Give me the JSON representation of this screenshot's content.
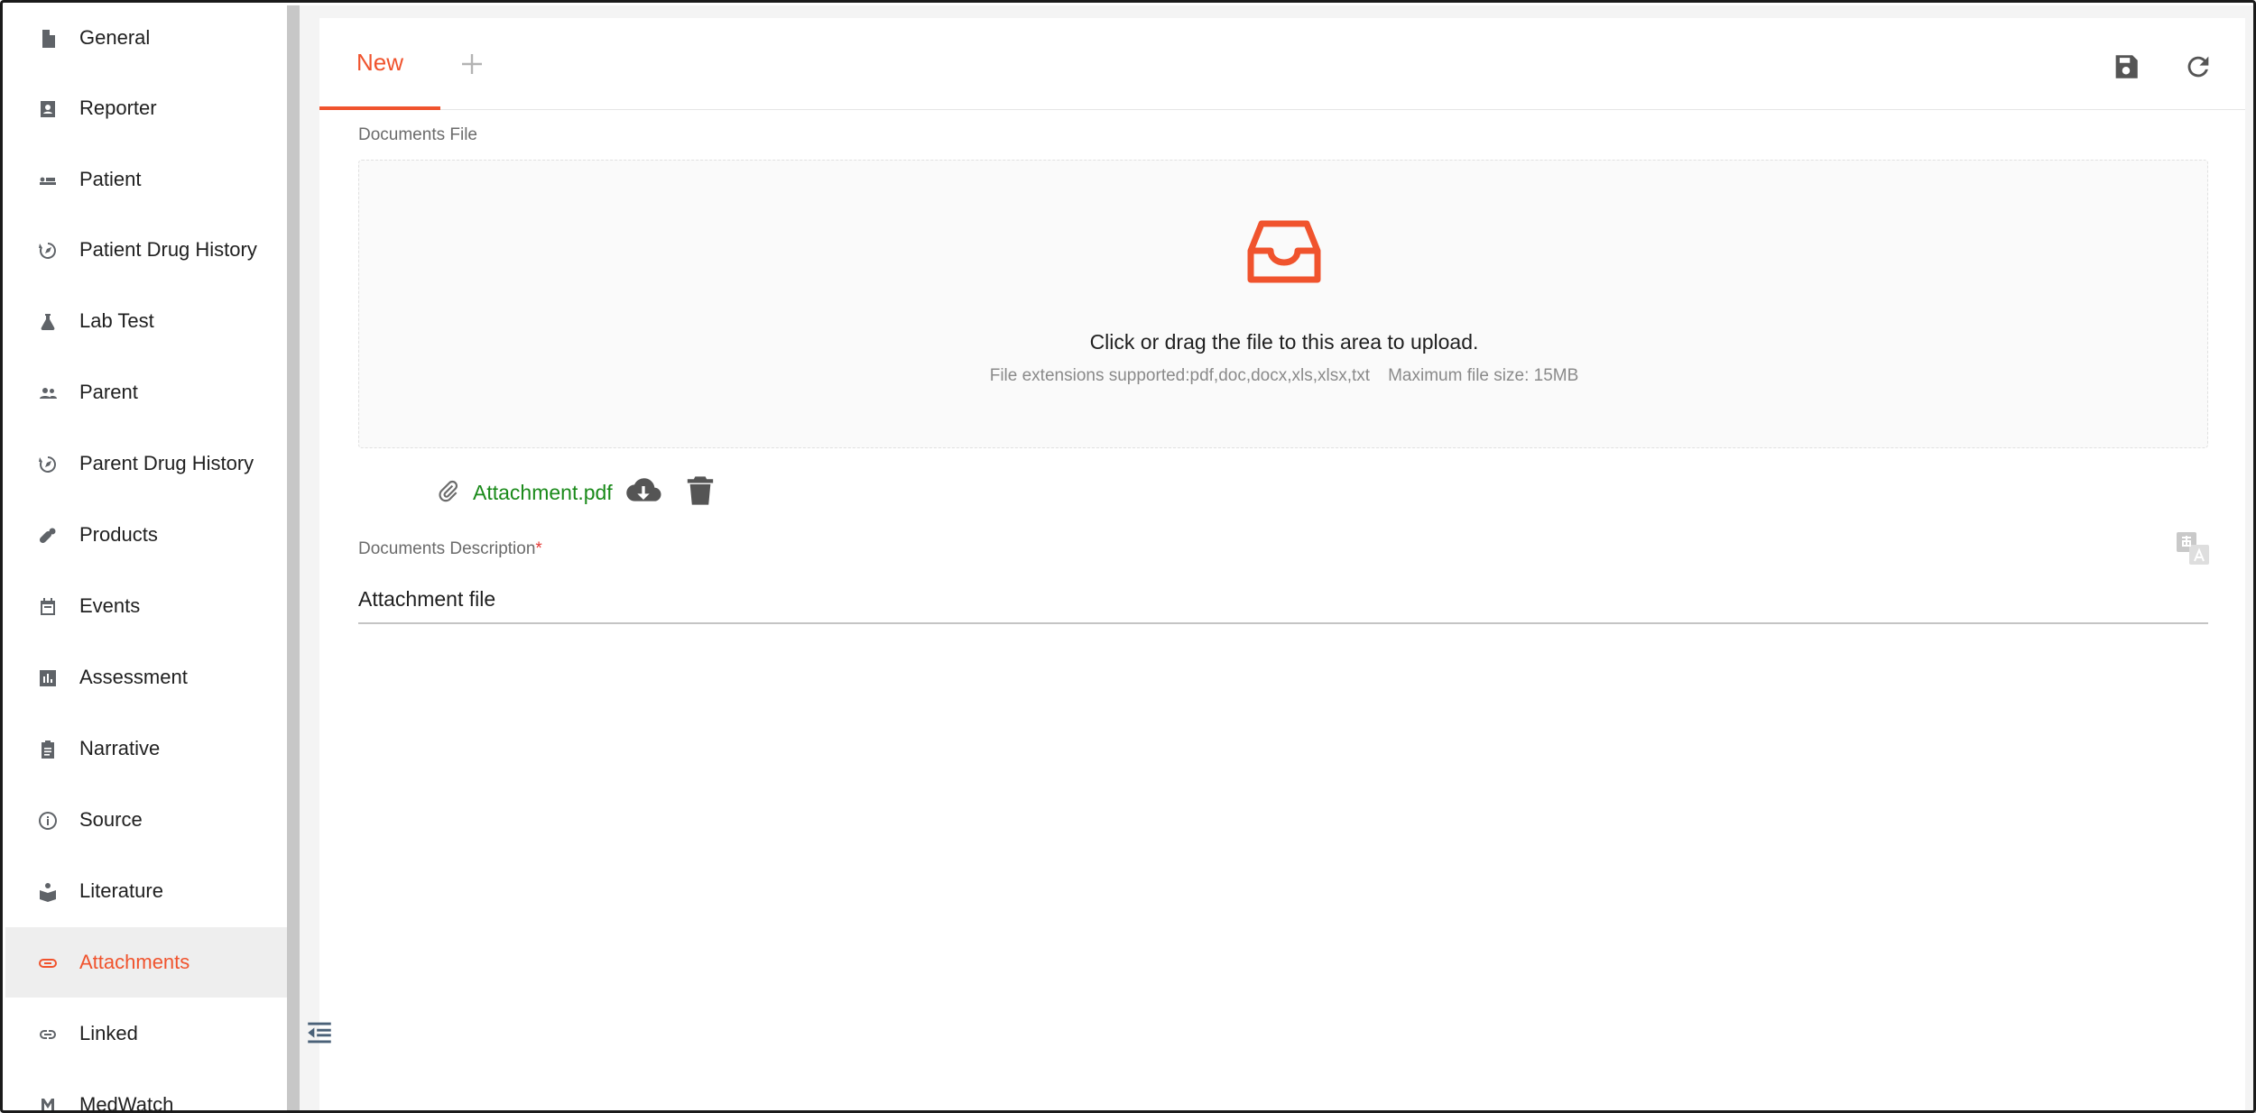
{
  "sidebar": {
    "items": [
      {
        "label": "General",
        "icon": "document-icon"
      },
      {
        "label": "Reporter",
        "icon": "contact-card-icon"
      },
      {
        "label": "Patient",
        "icon": "patient-bed-icon"
      },
      {
        "label": "Patient Drug History",
        "icon": "history-compass-icon"
      },
      {
        "label": "Lab Test",
        "icon": "lab-flask-icon"
      },
      {
        "label": "Parent",
        "icon": "people-icon"
      },
      {
        "label": "Parent Drug History",
        "icon": "history-compass-icon"
      },
      {
        "label": "Products",
        "icon": "pills-icon"
      },
      {
        "label": "Events",
        "icon": "calendar-icon"
      },
      {
        "label": "Assessment",
        "icon": "bar-chart-icon"
      },
      {
        "label": "Narrative",
        "icon": "clipboard-icon"
      },
      {
        "label": "Source",
        "icon": "info-icon"
      },
      {
        "label": "Literature",
        "icon": "reading-icon"
      },
      {
        "label": "Attachments",
        "icon": "paperclip-icon",
        "active": true
      },
      {
        "label": "Linked",
        "icon": "link-icon"
      },
      {
        "label": "MedWatch",
        "icon": "medwatch-icon"
      }
    ],
    "active_color": "#f0532d"
  },
  "tabs": {
    "new_label": "New",
    "add_icon": "plus-icon"
  },
  "toolbar": {
    "save_icon": "save-icon",
    "refresh_icon": "refresh-icon"
  },
  "documents_file": {
    "label": "Documents File",
    "upload_text": "Click or drag the file to this area to upload.",
    "extensions_hint": "File extensions supported:pdf,doc,docx,xls,xlsx,txt",
    "max_size_hint": "Maximum file size: 15MB"
  },
  "attachment": {
    "file_name": "Attachment.pdf"
  },
  "documents_description": {
    "label": "Documents Description",
    "required_mark": "*",
    "value": "Attachment file"
  },
  "colors": {
    "accent": "#f0532d",
    "link_green": "#1a8a1a"
  }
}
